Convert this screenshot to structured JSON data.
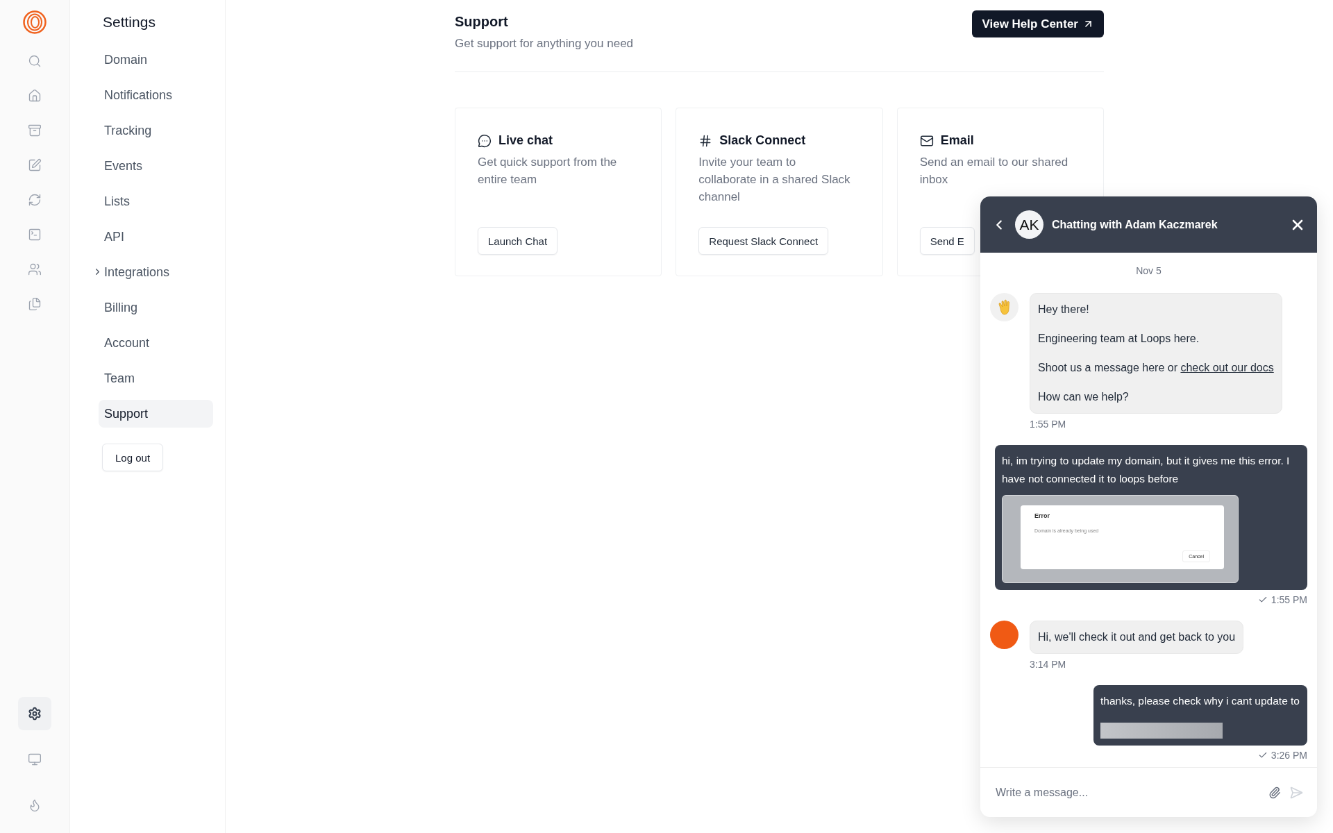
{
  "rail": {
    "top": [
      {
        "kind": "search",
        "selected": false
      },
      {
        "kind": "home",
        "selected": false
      },
      {
        "kind": "archive",
        "selected": false
      },
      {
        "kind": "edit",
        "selected": false
      },
      {
        "kind": "refresh",
        "selected": false
      },
      {
        "kind": "terminal",
        "selected": false
      },
      {
        "kind": "users",
        "selected": false
      },
      {
        "kind": "files",
        "selected": false
      }
    ],
    "bottom": [
      {
        "kind": "settings",
        "selected": true
      },
      {
        "kind": "monitor",
        "selected": false
      },
      {
        "kind": "flame",
        "selected": false
      }
    ]
  },
  "settings_nav": {
    "title": "Settings",
    "items": [
      {
        "label": "Domain",
        "selected": false,
        "expandable": false
      },
      {
        "label": "Notifications",
        "selected": false,
        "expandable": false
      },
      {
        "label": "Tracking",
        "selected": false,
        "expandable": false
      },
      {
        "label": "Events",
        "selected": false,
        "expandable": false
      },
      {
        "label": "Lists",
        "selected": false,
        "expandable": false
      },
      {
        "label": "API",
        "selected": false,
        "expandable": false
      },
      {
        "label": "Integrations",
        "selected": false,
        "expandable": true
      },
      {
        "label": "Billing",
        "selected": false,
        "expandable": false
      },
      {
        "label": "Account",
        "selected": false,
        "expandable": false
      },
      {
        "label": "Team",
        "selected": false,
        "expandable": false
      },
      {
        "label": "Support",
        "selected": true,
        "expandable": false
      }
    ],
    "logout": "Log out"
  },
  "header": {
    "title": "Support",
    "subtitle": "Get support for anything you need",
    "help_button": "View Help Center"
  },
  "cards": [
    {
      "kind": "chat",
      "title": "Live chat",
      "description": "Get quick support from the entire team",
      "button": "Launch Chat"
    },
    {
      "kind": "slack",
      "title": "Slack Connect",
      "description": "Invite your team to collaborate in a shared Slack channel",
      "button": "Request Slack Connect"
    },
    {
      "kind": "mail",
      "title": "Email",
      "description": "Send an email to our shared inbox",
      "button": "Send E"
    }
  ],
  "chat": {
    "initials": "AK",
    "title": "Chatting with Adam Kaczmarek",
    "date": "Nov 5",
    "messages": [
      {
        "kind": "agent",
        "avatar": {
          "kind": "wave"
        },
        "paragraphs": [
          {
            "text": "Hey there!"
          },
          {
            "text": "Engineering team at Loops here."
          },
          {
            "text": "Shoot us a message here or ",
            "link": "check out our docs"
          },
          {
            "text": "How can we help?"
          }
        ],
        "time": "1:55 PM"
      },
      {
        "kind": "user",
        "paragraphs": [
          {
            "text": "hi, im trying to update my domain, but it gives me this error. I have not connected it to loops before"
          }
        ],
        "attachment": {
          "kind": "screenshot",
          "dialog_title": "Error",
          "dialog_text": "Domain is already being used",
          "dialog_button": "Cancel"
        },
        "time": "1:55 PM",
        "delivered": true
      },
      {
        "kind": "agent",
        "avatar": {
          "kind": "photo"
        },
        "paragraphs": [
          {
            "text": "Hi, we'll check it out and get back to you"
          }
        ],
        "time": "3:14 PM"
      },
      {
        "kind": "user",
        "paragraphs": [
          {
            "text": "thanks, please check why i cant update to"
          }
        ],
        "attachment": {
          "kind": "redacted"
        },
        "time": "3:26 PM",
        "delivered": true
      }
    ],
    "input": {
      "placeholder": "Write a message..."
    }
  }
}
